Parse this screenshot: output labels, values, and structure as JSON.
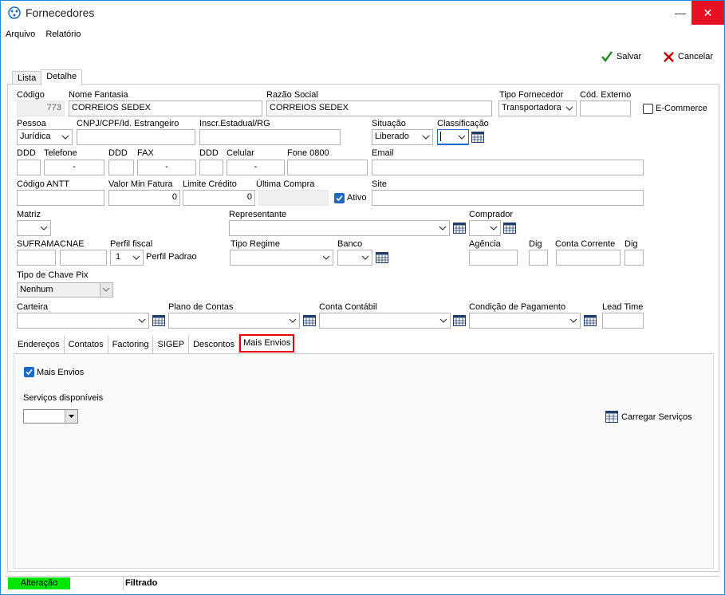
{
  "window": {
    "title": "Fornecedores",
    "min_glyph": "—",
    "close_glyph": "✕"
  },
  "menu": {
    "arquivo": "Arquivo",
    "relatorio": "Relatório"
  },
  "toolbar": {
    "save_label": "Salvar",
    "cancel_label": "Cancelar"
  },
  "tabs": {
    "lista": "Lista",
    "detalhe": "Detalhe"
  },
  "fields": {
    "codigo_label": "Código",
    "codigo_value": "773",
    "nome_fantasia_label": "Nome Fantasia",
    "nome_fantasia_value": "CORREIOS SEDEX",
    "razao_social_label": "Razão Social",
    "razao_social_value": "CORREIOS SEDEX",
    "tipo_fornecedor_label": "Tipo Fornecedor",
    "tipo_fornecedor_value": "Transportadora",
    "cod_externo_label": "Cód. Externo",
    "cod_externo_value": "",
    "ecommerce_label": "E-Commerce",
    "pessoa_label": "Pessoa",
    "pessoa_value": "Jurídica",
    "cnpj_label": "CNPJ/CPF/Id. Estrangeiro",
    "inscr_label": "Inscr.Estadual/RG",
    "situacao_label": "Situação",
    "situacao_value": "Liberado",
    "classificacao_label": "Classificação",
    "ddd_label": "DDD",
    "telefone_label": "Telefone",
    "telefone_value": "-",
    "ddd2_label": "DDD",
    "fax_label": "FAX",
    "fax_value": "-",
    "ddd3_label": "DDD",
    "celular_label": "Celular",
    "celular_value": "-",
    "fone0800_label": "Fone 0800",
    "email_label": "Email",
    "antt_label": "Código ANTT",
    "valor_min_label": "Valor Min Fatura",
    "valor_min_value": "0",
    "limite_label": "Limite Crédito",
    "limite_value": "0",
    "ultima_compra_label": "Última Compra",
    "ativo_label": "Ativo",
    "site_label": "Site",
    "matriz_label": "Matriz",
    "representante_label": "Representante",
    "comprador_label": "Comprador",
    "suframa_label": "SUFRAMA",
    "cnae_label": "CNAE",
    "perfil_fiscal_label": "Perfil fiscal",
    "perfil_fiscal_value": "1",
    "perfil_padrao_label": "Perfil Padrao",
    "tipo_regime_label": "Tipo Regime",
    "banco_label": "Banco",
    "agencia_label": "Agência",
    "dig_label": "Dig",
    "conta_corrente_label": "Conta Corrente",
    "dig2_label": "Dig",
    "tipo_chave_pix_label": "Tipo de Chave Pix",
    "tipo_chave_pix_value": "Nenhum",
    "carteira_label": "Carteira",
    "plano_contas_label": "Plano de Contas",
    "conta_contabil_label": "Conta Contábil",
    "cond_pagamento_label": "Condição de Pagamento",
    "lead_time_label": "Lead Time"
  },
  "subtabs": [
    "Endereços",
    "Contatos",
    "Factoring",
    "SIGEP",
    "Descontos",
    "Mais Envios"
  ],
  "mais_envios": {
    "checkbox_label": "Mais Envios",
    "servicos_label": "Serviços disponíveis",
    "carregar_label": "Carregar Serviços"
  },
  "status": {
    "mode": "Alteração",
    "filter": "Filtrado"
  },
  "colors": {
    "accent": "#1c69c5",
    "highlight": "#e8000b",
    "status_green": "#00e600",
    "close": "#e81123"
  }
}
